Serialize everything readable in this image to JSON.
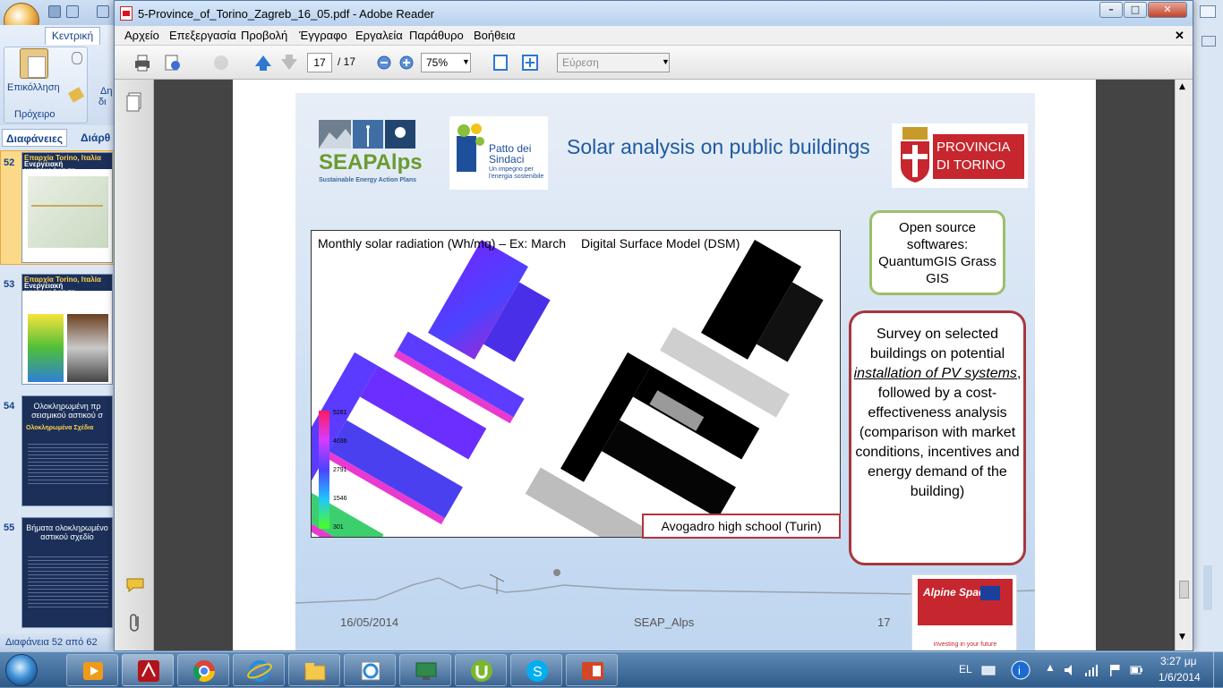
{
  "powerpoint": {
    "tab_home": "Κεντρική",
    "paste_label": "Επικόλληση",
    "clipboard_group": "Πρόχειρο",
    "partial_label": "Δη",
    "partial_label2": "δι",
    "panel_tab_slides": "Διαφάνειες",
    "panel_tab_outline": "Διάρθ",
    "slides": [
      {
        "number": "52",
        "title": "Επαρχία Torino, Ιταλία",
        "subtitle": "Ενεργειακή χαρτογράφηση"
      },
      {
        "number": "53",
        "title": "Επαρχία Torino, Ιταλία",
        "subtitle": "Ενεργειακή χαρτογράφηση"
      },
      {
        "number": "54",
        "title": "Ολοκληρωμένη πρ σεισμικού αστικού σ",
        "subtitle": "Ολοκληρωμένα Σχέδια"
      },
      {
        "number": "55",
        "title": "Βήματα ολοκληρωμένο αστικού σχεδίο",
        "subtitle": ""
      }
    ],
    "status": "Διαφάνεια 52 από 62"
  },
  "reader": {
    "window_title": "5-Province_of_Torino_Zagreb_16_05.pdf - Adobe Reader",
    "menu": [
      "Αρχείο",
      "Επεξεργασία",
      "Προβολή",
      "Έγγραφο",
      "Εργαλεία",
      "Παράθυρο",
      "Βοήθεια"
    ],
    "page_current": "17",
    "page_total": "/ 17",
    "zoom": "75%",
    "search_placeholder": "Εύρεση"
  },
  "slide": {
    "title": "Solar analysis on public buildings",
    "logo_seap": "SEAPAlps",
    "logo_seap_tagline": "Sustainable Energy Action Plans",
    "logo_patto": "Patto dei Sindaci",
    "logo_patto_tagline": "Un impegno per l'energia sostenibile",
    "logo_provincia": "PROVINCIA DI TORINO",
    "figure_left_label": "Monthly solar radiation (Wh/mq) – Ex: March",
    "figure_right_label": "Digital Surface Model (DSM)",
    "legend_values": [
      "5281",
      "4036",
      "2791",
      "1546",
      "301"
    ],
    "figure_caption": "Avogadro high school (Turin)",
    "green_box": "Open source softwares: QuantumGIS Grass GIS",
    "red_box_part1": "Survey on selected buildings on potential ",
    "red_box_emph": "installation of  PV systems",
    "red_box_part2": ", followed by a cost-effectiveness analysis (comparison with market conditions, incentives and energy demand of the building)",
    "footer_date": "16/05/2014",
    "footer_center": "SEAP_Alps",
    "footer_page": "17",
    "alpine_logo": "Alpine Space",
    "alpine_tagline": "investing in your future"
  },
  "taskbar": {
    "language": "EL",
    "time": "3:27 μμ",
    "date": "1/6/2014",
    "apps": [
      "media-player-icon",
      "adobe-reader-icon",
      "chrome-icon",
      "ie-icon",
      "explorer-icon",
      "ie-icon-2",
      "remote-desktop-icon",
      "utorrent-icon",
      "skype-icon",
      "powerpoint-icon"
    ]
  },
  "colors": {
    "slide_title": "#1f5aa0",
    "green_border": "#9cbf6a",
    "red_border": "#a8373c",
    "taskbar": "#2f5b8b"
  }
}
